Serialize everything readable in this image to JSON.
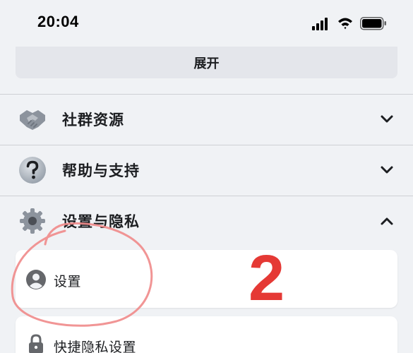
{
  "status_bar": {
    "time": "20:04",
    "signal_icon": "cellular-signal-icon",
    "wifi_icon": "wifi-icon",
    "battery_icon": "battery-icon"
  },
  "expand_button": {
    "label": "展开"
  },
  "menu": {
    "items": [
      {
        "label": "社群资源",
        "icon": "handshake-icon",
        "chevron": "chevron-down-icon",
        "expanded": false
      },
      {
        "label": "帮助与支持",
        "icon": "help-question-icon",
        "chevron": "chevron-down-icon",
        "expanded": false
      },
      {
        "label": "设置与隐私",
        "icon": "gear-icon",
        "chevron": "chevron-up-icon",
        "expanded": true
      }
    ],
    "settings_subitems": [
      {
        "label": "设置",
        "icon": "user-profile-icon"
      },
      {
        "label": "快捷隐私设置",
        "icon": "lock-icon"
      }
    ]
  },
  "annotation": {
    "number": "2",
    "color": "#e53935",
    "circle_color": "#f08a8a"
  },
  "colors": {
    "background": "#f0f2f5",
    "card": "#ffffff",
    "button": "#e4e6eb",
    "divider": "#ced0d4",
    "text": "#1c1e21"
  }
}
